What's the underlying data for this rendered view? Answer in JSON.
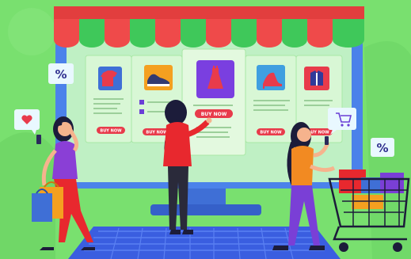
{
  "illustration": {
    "background": "#79e06f",
    "monitor_color": "#4b82ea",
    "screen_color": "#bff0c4",
    "awning_colors": [
      "#ef4a4a",
      "#3fc85a"
    ],
    "keyboard_color": "#3a5ee0"
  },
  "product_cards": [
    {
      "icon": "tshirt-icon",
      "button_label": "BUY NOW"
    },
    {
      "icon": "sneaker-icon",
      "button_label": "BUY NOW"
    },
    {
      "icon": "dress-icon",
      "button_label": "BUY NOW"
    },
    {
      "icon": "high-heel-icon",
      "button_label": "BUY NOW"
    },
    {
      "icon": "jacket-icon",
      "button_label": "BUY NOW"
    }
  ],
  "badges": [
    {
      "icon": "percent-icon",
      "text": "%"
    },
    {
      "icon": "percent-icon",
      "text": "%"
    }
  ],
  "bubbles": [
    {
      "icon": "heart-icon"
    },
    {
      "icon": "shopping-cart-icon"
    }
  ],
  "people": [
    {
      "role": "woman-with-shopping-bags"
    },
    {
      "role": "woman-pointing-at-screen"
    },
    {
      "role": "woman-with-shopping-cart"
    }
  ]
}
